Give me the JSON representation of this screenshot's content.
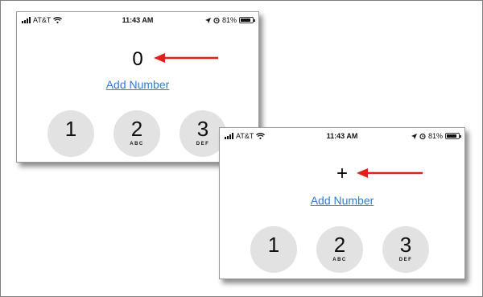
{
  "screens": [
    {
      "status": {
        "carrier": "AT&T",
        "time": "11:43 AM",
        "battery": "81%"
      },
      "display_value": "0",
      "add_number_label": "Add Number",
      "keys": [
        {
          "digit": "1",
          "letters": ""
        },
        {
          "digit": "2",
          "letters": "ABC"
        },
        {
          "digit": "3",
          "letters": "DEF"
        }
      ]
    },
    {
      "status": {
        "carrier": "AT&T",
        "time": "11:43 AM",
        "battery": "81%"
      },
      "display_value": "+",
      "add_number_label": "Add Number",
      "keys": [
        {
          "digit": "1",
          "letters": ""
        },
        {
          "digit": "2",
          "letters": "ABC"
        },
        {
          "digit": "3",
          "letters": "DEF"
        }
      ]
    }
  ],
  "colors": {
    "arrow": "#e0201b",
    "link": "#2f7bd6",
    "key_bg": "#e2e2e2"
  },
  "icons": [
    "signal-bars-icon",
    "wifi-icon",
    "location-arrow-icon",
    "alarm-clock-icon",
    "battery-icon",
    "red-arrow-icon"
  ]
}
